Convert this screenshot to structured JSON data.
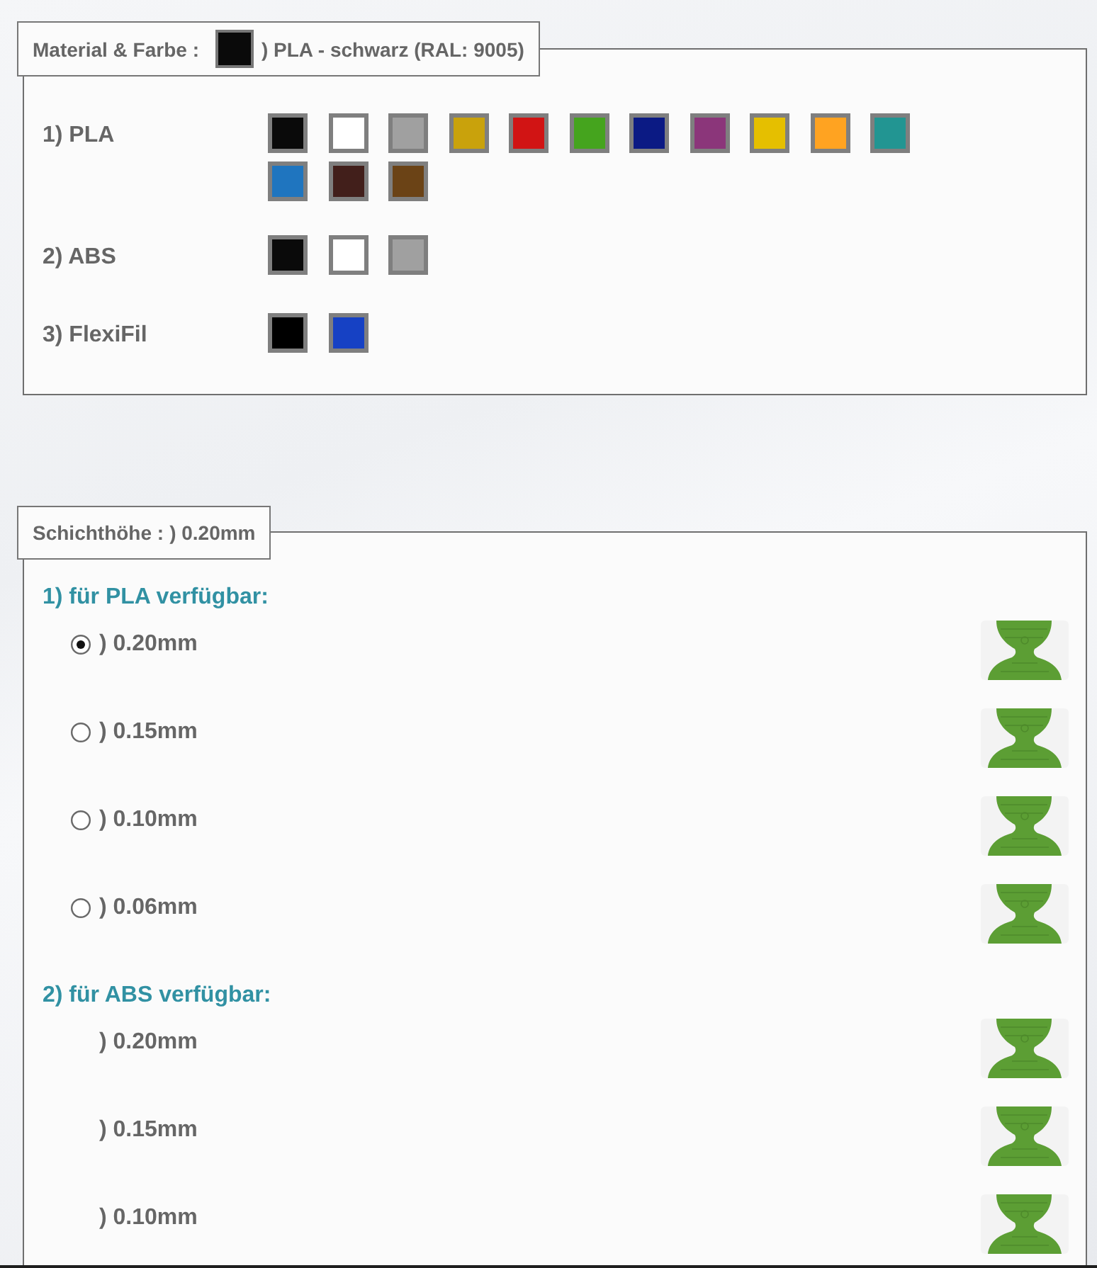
{
  "material_section": {
    "legend": {
      "label": "Material & Farbe :",
      "color": "#0a0a0a",
      "value": ") PLA - schwarz (RAL: 9005)"
    },
    "materials": [
      {
        "label": "1) PLA",
        "swatches": [
          {
            "color": "#0a0a0a"
          },
          {
            "color": "#ffffff"
          },
          {
            "color": "#a0a0a0"
          },
          {
            "color": "#c9a20c"
          },
          {
            "color": "#d11414"
          },
          {
            "color": "#45a41e"
          },
          {
            "color": "#0b1a84"
          },
          {
            "color": "#8b367a"
          },
          {
            "color": "#e5bf00"
          },
          {
            "color": "#ffa321"
          },
          {
            "color": "#229592"
          },
          {
            "color": "#1f75bf"
          },
          {
            "color": "#421f1b"
          },
          {
            "color": "#6b4316"
          }
        ]
      },
      {
        "label": "2) ABS",
        "swatches": [
          {
            "color": "#0a0a0a"
          },
          {
            "color": "#ffffff"
          },
          {
            "color": "#a0a0a0"
          }
        ]
      },
      {
        "label": "3) FlexiFil",
        "swatches": [
          {
            "color": "#000000"
          },
          {
            "color": "#1641c4"
          }
        ]
      }
    ]
  },
  "layer_section": {
    "legend": {
      "label": "Schichthöhe :",
      "value": ") 0.20mm"
    },
    "groups": [
      {
        "heading": "1) für PLA verfügbar:",
        "kind": "radio",
        "options": [
          {
            "label": ") 0.20mm",
            "selected": true
          },
          {
            "label": ") 0.15mm",
            "selected": false
          },
          {
            "label": ") 0.10mm",
            "selected": false
          },
          {
            "label": ") 0.06mm",
            "selected": false
          }
        ]
      },
      {
        "heading": "2) für ABS verfügbar:",
        "kind": "plain",
        "options": [
          {
            "label": ") 0.20mm"
          },
          {
            "label": ") 0.15mm"
          },
          {
            "label": ") 0.10mm"
          }
        ]
      }
    ]
  }
}
